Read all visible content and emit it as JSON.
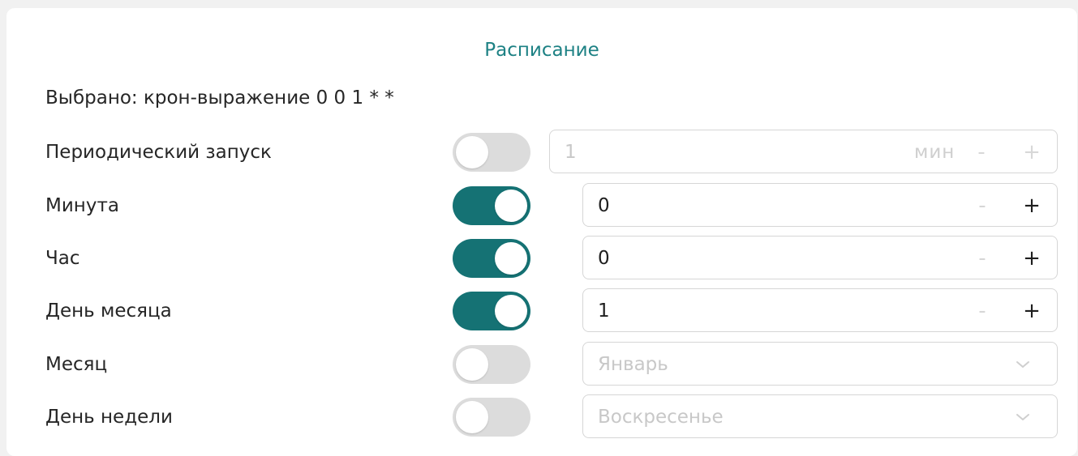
{
  "header": {
    "title": "Расписание",
    "selected_text": "Выбрано: крон-выражение 0 0 1 * *"
  },
  "rows": [
    {
      "label": "Периодический запуск",
      "enabled": false,
      "value": "1",
      "unit": "мин",
      "minus": "-",
      "plus": "+"
    },
    {
      "label": "Минута",
      "enabled": true,
      "value": "0",
      "minus": "-",
      "plus": "+"
    },
    {
      "label": "Час",
      "enabled": true,
      "value": "0",
      "minus": "-",
      "plus": "+"
    },
    {
      "label": "День месяца",
      "enabled": true,
      "value": "1",
      "minus": "-",
      "plus": "+"
    },
    {
      "label": "Месяц",
      "enabled": false,
      "value": "Январь",
      "icon": "chevron-down-icon"
    },
    {
      "label": "День недели",
      "enabled": false,
      "value": "Воскресенье",
      "icon": "chevron-down-icon"
    }
  ],
  "colors": {
    "accent": "#157274",
    "title": "#1d8184",
    "toggle_off": "#dcdcdc",
    "border": "#d6d6d6"
  }
}
